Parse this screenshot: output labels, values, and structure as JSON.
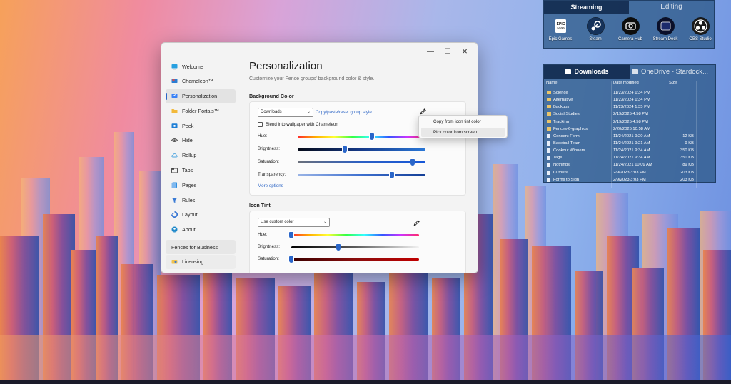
{
  "colors": {
    "accent": "#2a66c9",
    "link": "#2a63c4",
    "fence_bg": "#28557f",
    "fence_tab_active": "#142d50"
  },
  "settings_window": {
    "controls": {
      "minimize_icon": "minimize-icon",
      "maximize_icon": "maximize-icon",
      "close_icon": "close-icon"
    },
    "sidebar": {
      "items": [
        {
          "label": "Welcome",
          "icon": "monitor-icon",
          "icon_color": "#28a0e0"
        },
        {
          "label": "Chameleon™",
          "icon": "chameleon-icon",
          "icon_color": "#2d7dd2"
        },
        {
          "label": "Personalization",
          "icon": "personalize-icon",
          "icon_color": "#3b82f6",
          "active": true
        },
        {
          "label": "Folder Portals™",
          "icon": "folder-icon",
          "icon_color": "#f2b93b"
        },
        {
          "label": "Peek",
          "icon": "peek-icon",
          "icon_color": "#1f7fd6"
        },
        {
          "label": "Hide",
          "icon": "eye-icon",
          "icon_color": "#555555"
        },
        {
          "label": "Rollup",
          "icon": "cloud-icon",
          "icon_color": "#4aa3df"
        },
        {
          "label": "Tabs",
          "icon": "tabs-icon",
          "icon_color": "#444444"
        },
        {
          "label": "Pages",
          "icon": "pages-icon",
          "icon_color": "#2f8fe0"
        },
        {
          "label": "Rules",
          "icon": "filter-icon",
          "icon_color": "#3a7bd5"
        },
        {
          "label": "Layout",
          "icon": "layout-icon",
          "icon_color": "#2d6fd1"
        },
        {
          "label": "About",
          "icon": "user-icon",
          "icon_color": "#1e88c9"
        }
      ],
      "bottom_items": [
        {
          "label": "Fences for Business"
        },
        {
          "label": "Licensing",
          "icon": "license-icon"
        }
      ]
    },
    "page_title": "Personalization",
    "page_subtitle": "Customize your Fence groups' background color & style.",
    "background_color": {
      "section_title": "Background Color",
      "dropdown_value": "Downloads",
      "copy_link": "Copy/paste/reset group style",
      "blend_checkbox_label": "Blend into wallpaper with Chameleon",
      "blend_checked": false,
      "sliders": [
        {
          "label": "Hue:",
          "value": 0.58,
          "kind": "rainbow"
        },
        {
          "label": "Brightness:",
          "value": 0.37,
          "kind": "dark-to-blue"
        },
        {
          "label": "Saturation:",
          "value": 0.9,
          "kind": "gray-to-blue"
        },
        {
          "label": "Transparency:",
          "value": 0.74,
          "kind": "blue-fade"
        }
      ],
      "more_options": "More options"
    },
    "icon_tint": {
      "section_title": "Icon Tint",
      "dropdown_value": "Use custom color",
      "sliders": [
        {
          "label": "Hue:",
          "value": 0.0,
          "kind": "rainbow"
        },
        {
          "label": "Brightness:",
          "value": 0.37,
          "kind": "dark-to-white"
        },
        {
          "label": "Saturation:",
          "value": 0.0,
          "kind": "dark-red"
        }
      ]
    },
    "context_menu": {
      "items": [
        {
          "label": "Copy from icon tint color"
        },
        {
          "label": "Pick color from screen",
          "hover": true
        }
      ]
    }
  },
  "fence_streaming": {
    "tabs": [
      {
        "label": "Streaming",
        "active": true
      },
      {
        "label": "Editing",
        "active": false
      }
    ],
    "shortcuts": [
      {
        "label": "Epic Games",
        "icon": "epic-games-icon"
      },
      {
        "label": "Steam",
        "icon": "steam-icon"
      },
      {
        "label": "Camera Hub",
        "icon": "camera-icon"
      },
      {
        "label": "Stream Deck",
        "icon": "stream-deck-icon"
      },
      {
        "label": "OBS Studio",
        "icon": "obs-icon"
      }
    ]
  },
  "fence_files": {
    "tabs": [
      {
        "label": "Downloads",
        "active": true
      },
      {
        "label": "OneDrive - Stardock...",
        "active": false
      }
    ],
    "columns": {
      "name": "Name",
      "date": "Date modified",
      "size": "Size"
    },
    "rows": [
      {
        "name": "Science",
        "date": "11/23/2024 1:34 PM",
        "size": "",
        "type": "folder"
      },
      {
        "name": "Alternative",
        "date": "11/23/2024 1:34 PM",
        "size": "",
        "type": "folder"
      },
      {
        "name": "Backups",
        "date": "11/23/2024 1:35 PM",
        "size": "",
        "type": "folder"
      },
      {
        "name": "Social Studies",
        "date": "2/19/2025 4:58 PM",
        "size": "",
        "type": "folder"
      },
      {
        "name": "Tracking",
        "date": "2/19/2025 4:58 PM",
        "size": "",
        "type": "folder"
      },
      {
        "name": "Fences-6-graphics",
        "date": "2/20/2025 10:58 AM",
        "size": "",
        "type": "folder"
      },
      {
        "name": "Consent Form",
        "date": "11/24/2021 9:20 AM",
        "size": "12 KB",
        "type": "file"
      },
      {
        "name": "Baseball Team",
        "date": "11/24/2021 9:21 AM",
        "size": "9 KB",
        "type": "file"
      },
      {
        "name": "Cookout Winners",
        "date": "11/24/2021 9:34 AM",
        "size": "350 KB",
        "type": "file"
      },
      {
        "name": "Tags",
        "date": "11/24/2021 9:34 AM",
        "size": "350 KB",
        "type": "file"
      },
      {
        "name": "Nothings",
        "date": "11/24/2021 10:09 AM",
        "size": "89 KB",
        "type": "file"
      },
      {
        "name": "Cutouts",
        "date": "2/9/2023 3:03 PM",
        "size": "203 KB",
        "type": "file"
      },
      {
        "name": "Forms to Sign",
        "date": "2/9/2023 3:03 PM",
        "size": "203 KB",
        "type": "file"
      }
    ]
  }
}
